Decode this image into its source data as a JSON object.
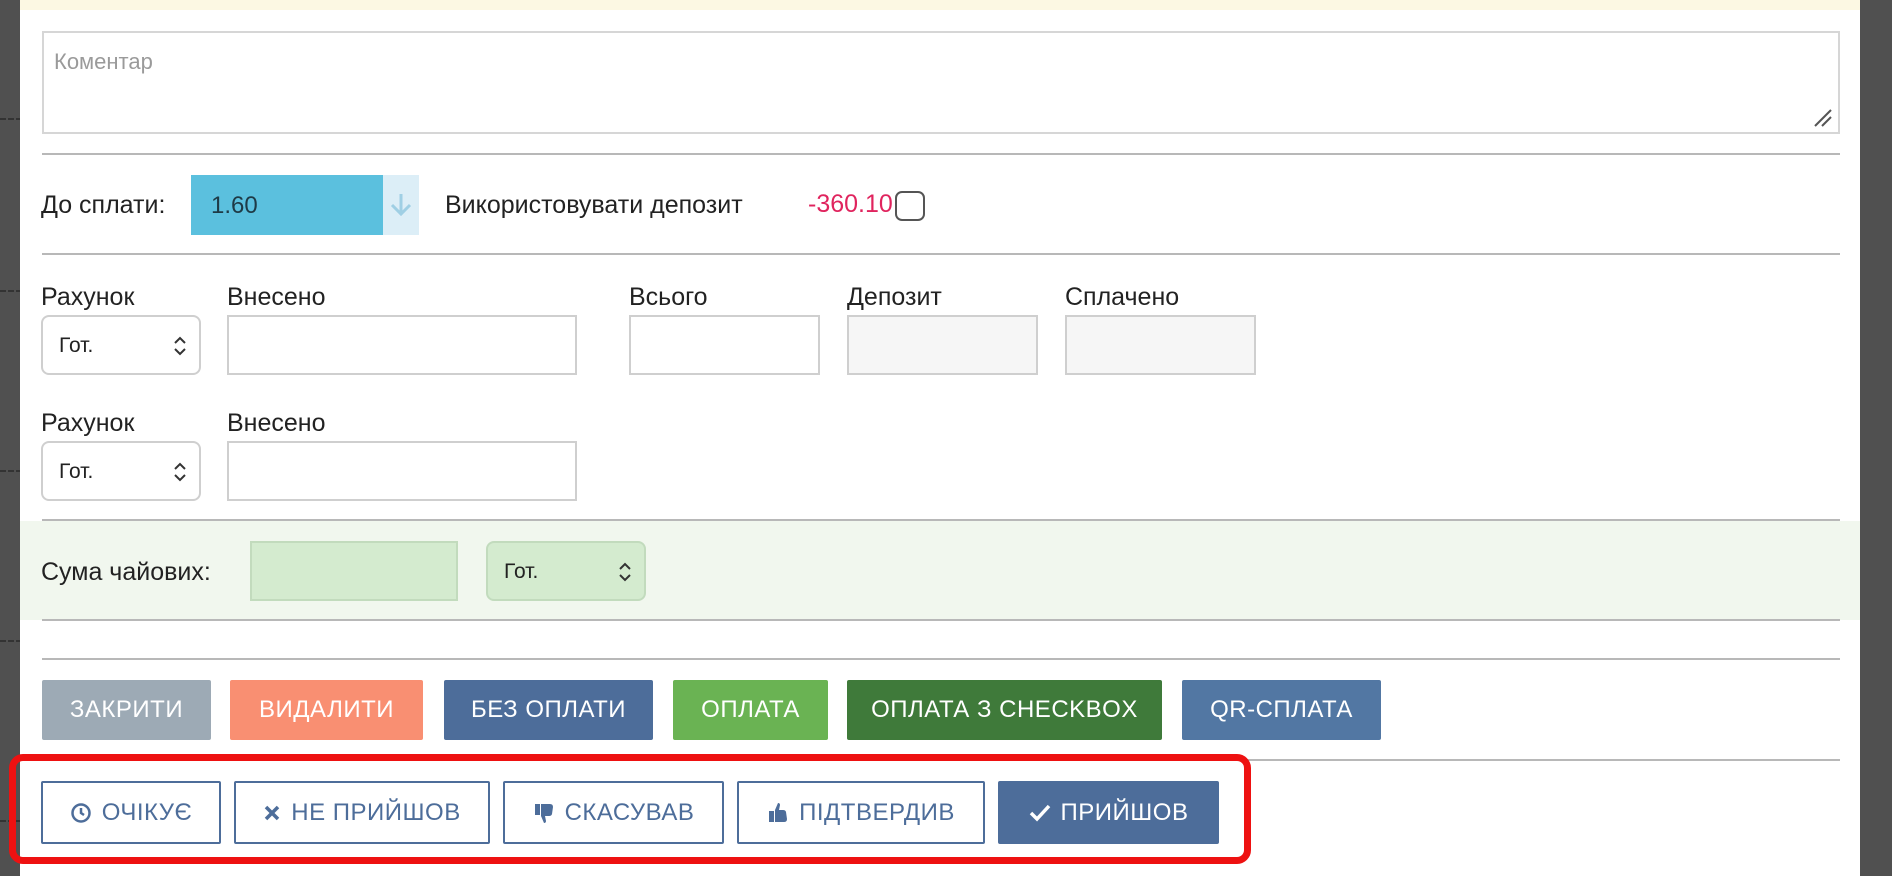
{
  "comment": {
    "placeholder": "Коментар",
    "value": ""
  },
  "payment": {
    "due_label": "До сплати:",
    "due_value": "1.60",
    "use_deposit_label": "Використовувати депозит",
    "deposit_amount": "-360.10"
  },
  "row1": {
    "account_label": "Рахунок",
    "account_value": "Гот.",
    "paid_in_label": "Внесено",
    "total_label": "Всього",
    "deposit_label": "Депозит",
    "paid_label": "Сплачено"
  },
  "row2": {
    "account_label": "Рахунок",
    "account_value": "Гот.",
    "paid_in_label": "Внесено"
  },
  "tips": {
    "label": "Сума чайових:",
    "account_value": "Гот."
  },
  "actions": {
    "close": "ЗАКРИТИ",
    "delete": "ВИДАЛИТИ",
    "no_payment": "БЕЗ ОПЛАТИ",
    "payment": "ОПЛАТА",
    "payment_checkbox": "ОПЛАТА З CHECKBOX",
    "qr_payment": "QR-СПЛАТА"
  },
  "status": {
    "waiting": "ОЧІКУЄ",
    "no_show": "НЕ ПРИЙШОВ",
    "cancelled": "СКАСУВАВ",
    "confirmed": "ПІДТВЕРДИВ",
    "arrived": "ПРИЙШОВ"
  },
  "colors": {
    "primary": "#4d6d9a",
    "info": "#5bc0de",
    "danger_text": "#e0245e",
    "highlight_frame": "#ee1111"
  }
}
